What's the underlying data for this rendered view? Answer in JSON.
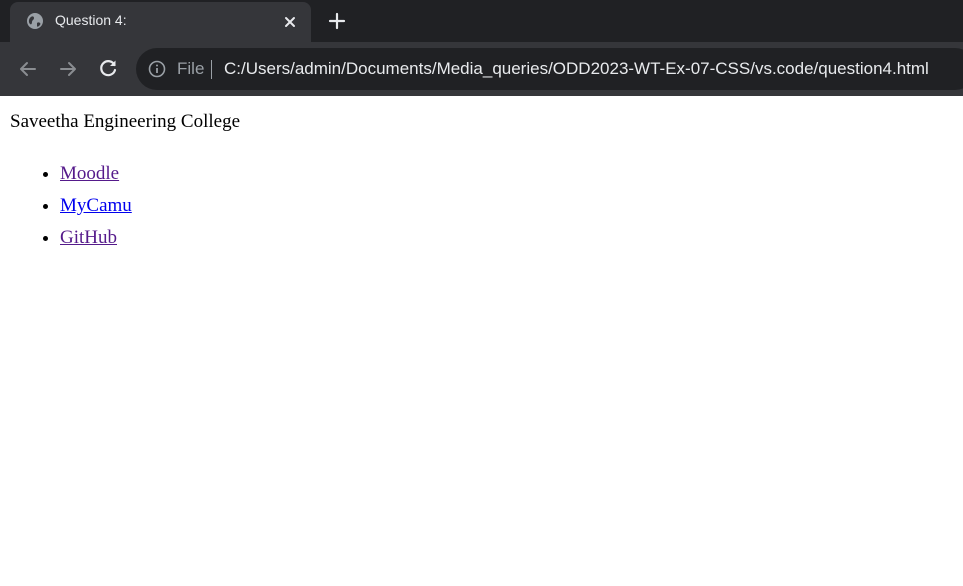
{
  "browser": {
    "tab": {
      "title": "Question 4:",
      "favicon": "globe-icon"
    },
    "toolbar": {
      "back": "back-arrow-icon",
      "forward": "forward-arrow-icon",
      "reload": "reload-icon"
    },
    "omnibox": {
      "scheme_label": "File",
      "url": "C:/Users/admin/Documents/Media_queries/ODD2023-WT-Ex-07-CSS/vs.code/question4.html"
    }
  },
  "page": {
    "title": "Saveetha Engineering College",
    "links": [
      {
        "label": "Moodle",
        "visited": true
      },
      {
        "label": "MyCamu",
        "visited": false
      },
      {
        "label": "GitHub",
        "visited": true
      }
    ]
  },
  "colors": {
    "tabstrip_bg": "#202124",
    "tab_bg": "#35363a",
    "text_light": "#e8eaed",
    "text_muted": "#9aa0a6",
    "link_unvisited": "#0000ee",
    "link_visited": "#551a8b"
  }
}
